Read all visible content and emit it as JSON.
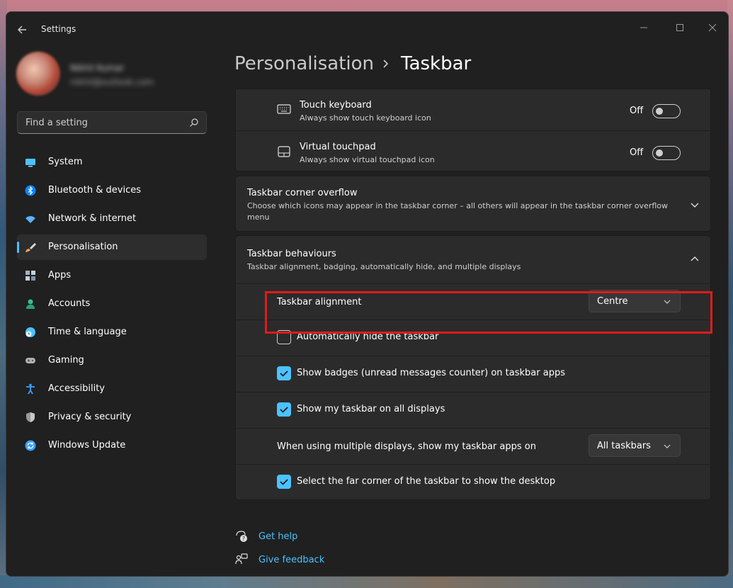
{
  "window": {
    "title": "Settings"
  },
  "profile": {
    "name": "Nikhil Kumar",
    "email": "nikhil@outlook.com"
  },
  "search": {
    "placeholder": "Find a setting"
  },
  "nav": {
    "items": [
      {
        "label": "System",
        "icon": "monitor-icon",
        "color": "#4cc2ff"
      },
      {
        "label": "Bluetooth & devices",
        "icon": "bluetooth-icon",
        "color": "#0a84ff"
      },
      {
        "label": "Network & internet",
        "icon": "wifi-icon",
        "color": "#5ab2ff"
      },
      {
        "label": "Personalisation",
        "icon": "paintbrush-icon",
        "color": "#f0a35b",
        "active": true
      },
      {
        "label": "Apps",
        "icon": "apps-icon",
        "color": "#9fb3c8"
      },
      {
        "label": "Accounts",
        "icon": "person-icon",
        "color": "#36c28a"
      },
      {
        "label": "Time & language",
        "icon": "globe-clock-icon",
        "color": "#4cc2ff"
      },
      {
        "label": "Gaming",
        "icon": "gamepad-icon",
        "color": "#b0b0b0"
      },
      {
        "label": "Accessibility",
        "icon": "accessibility-icon",
        "color": "#3aa0ff"
      },
      {
        "label": "Privacy & security",
        "icon": "shield-icon",
        "color": "#9a9a9a"
      },
      {
        "label": "Windows Update",
        "icon": "update-icon",
        "color": "#3aa0ff"
      }
    ]
  },
  "breadcrumb": {
    "parent": "Personalisation",
    "current": "Taskbar"
  },
  "touch_keyboard": {
    "title": "Touch keyboard",
    "subtitle": "Always show touch keyboard icon",
    "state": "Off"
  },
  "virtual_touchpad": {
    "title": "Virtual touchpad",
    "subtitle": "Always show virtual touchpad icon",
    "state": "Off"
  },
  "corner_overflow": {
    "title": "Taskbar corner overflow",
    "subtitle": "Choose which icons may appear in the taskbar corner – all others will appear in the taskbar corner overflow menu"
  },
  "behaviours": {
    "title": "Taskbar behaviours",
    "subtitle": "Taskbar alignment, badging, automatically hide, and multiple displays",
    "alignment_label": "Taskbar alignment",
    "alignment_value": "Centre",
    "auto_hide_label": "Automatically hide the taskbar",
    "auto_hide_checked": false,
    "badges_label": "Show badges (unread messages counter) on taskbar apps",
    "badges_checked": true,
    "all_displays_label": "Show my taskbar on all displays",
    "all_displays_checked": true,
    "multi_display_label": "When using multiple displays, show my taskbar apps on",
    "multi_display_value": "All taskbars",
    "far_corner_label": "Select the far corner of the taskbar to show the desktop",
    "far_corner_checked": true
  },
  "help": {
    "get_help": "Get help",
    "give_feedback": "Give feedback"
  },
  "colors": {
    "accent": "#4cc2ff",
    "highlight": "#e01b1b",
    "window_bg": "#202020",
    "card_bg": "#2b2b2b"
  }
}
